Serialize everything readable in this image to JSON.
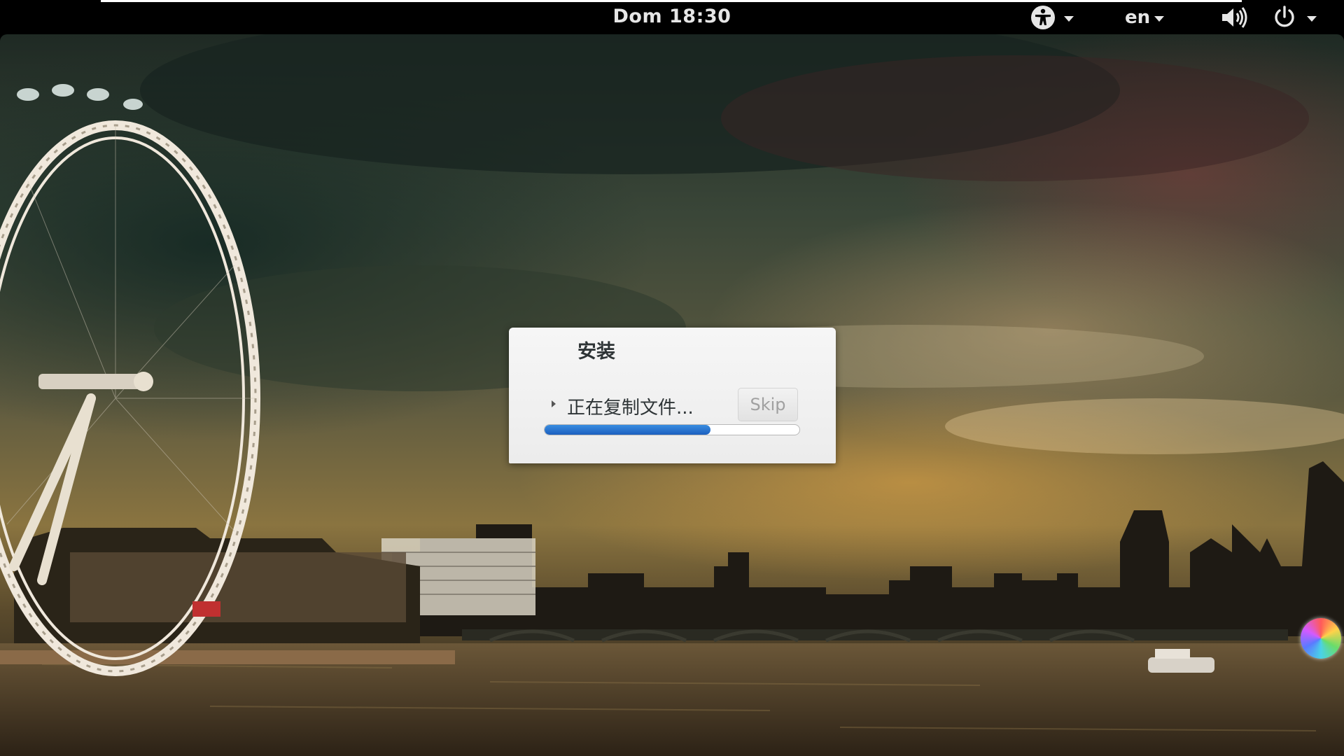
{
  "topbar": {
    "clock": "Dom 18:30",
    "accessibility_icon": "accessibility-icon",
    "language": "en",
    "volume_icon": "speaker-volume-icon",
    "power_icon": "power-icon"
  },
  "dialog": {
    "title": "安装",
    "status": "正在复制文件...",
    "skip_label": "Skip",
    "progress": 0.65,
    "colors": {
      "progress_fill": "#1b5fbf",
      "background": "#ececec"
    }
  },
  "wallpaper": {
    "description_icon": "london-eye-skyline-wallpaper"
  },
  "desktop_corner": {
    "icon": "color-wheel-icon"
  }
}
